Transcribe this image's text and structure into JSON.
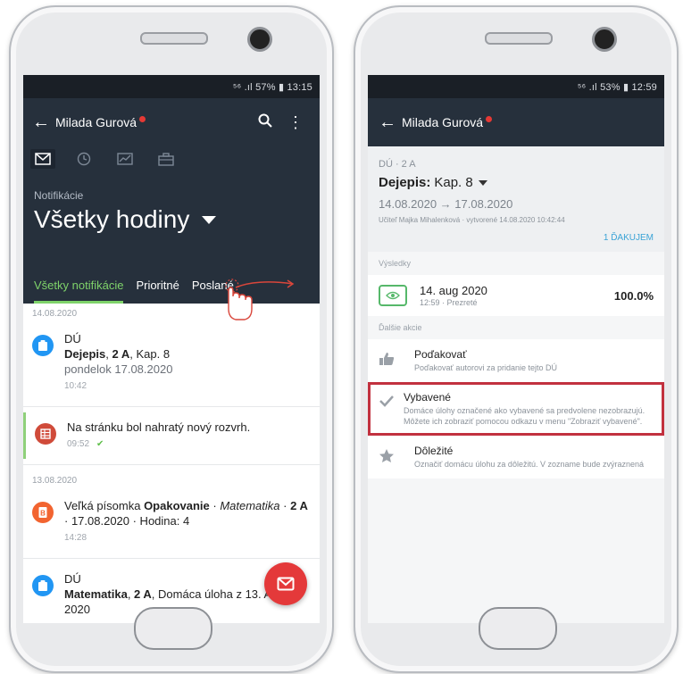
{
  "left_screen": {
    "statusbar": {
      "text": "⁵⁶ .ıl 57% ▮ 13:15"
    },
    "appbar": {
      "user_name": "Milada Gurová"
    },
    "hero": {
      "label": "Notifikácie",
      "title": "Všetky hodiny"
    },
    "tabs": [
      {
        "label": "Všetky notifikácie",
        "active": true
      },
      {
        "label": "Prioritné",
        "active": false
      },
      {
        "label": "Poslané",
        "active": false
      }
    ],
    "groups": [
      {
        "date": "14.08.2020",
        "items": [
          {
            "title": "DÚ",
            "line_bold": "Dejepis",
            "line_bold2": "2 A",
            "line_rest": ", Kap. 8",
            "line2": "pondelok 17.08.2020",
            "time": "10:42",
            "avatar_color": "#2196f3"
          },
          {
            "text": "Na stránku bol nahratý nový rozvrh.",
            "time": "09:52",
            "avatar_color": "#d04b3a"
          }
        ]
      },
      {
        "date": "13.08.2020",
        "items": [
          {
            "text_pre": "Veľká písomka ",
            "text_bold": "Opakovanie",
            "text_after": " · ",
            "text_italic": "Matematika",
            "text_mid": " · ",
            "text_bold2": "2 A",
            "text_end": " · 17.08.2020 · Hodina: 4",
            "time": "14:28",
            "avatar_color": "#f26430"
          },
          {
            "title": "DÚ",
            "line_bold": "Matematika",
            "line_bold2": "2 A",
            "line_rest": ", Domáca úloha z 13. Aug 2020",
            "avatar_color": "#2196f3"
          }
        ]
      }
    ]
  },
  "right_screen": {
    "statusbar": {
      "text": "⁵⁶ .ıl 53% ▮ 12:59"
    },
    "appbar": {
      "user_name": "Milada Gurová"
    },
    "header": {
      "kicker": "DÚ · 2 A",
      "subject_bold": "Dejepis:",
      "subject_rest": "Kap. 8",
      "dates": "14.08.2020 → 17.08.2020",
      "teacher": "Učiteľ Majka Mihalenková · vytvorené 14.08.2020 10:42:44",
      "thanks": "1 ĎAKUJEM"
    },
    "results_label": "Výsledky",
    "result": {
      "date": "14. aug 2020",
      "sub": "12:59 · Prezreté",
      "value": "100.0%"
    },
    "actions_label": "Ďalšie akcie",
    "actions": [
      {
        "title": "Poďakovať",
        "desc": "Poďakovať autorovi za pridanie tejto DÚ",
        "icon": "thumbs-up-icon"
      },
      {
        "title": "Vybavené",
        "desc": "Domáce úlohy označené ako vybavené sa predvolene nezobrazujú. Môžete ich zobraziť pomocou odkazu v menu \"Zobraziť vybavené\".",
        "icon": "check-icon"
      },
      {
        "title": "Dôležité",
        "desc": "Označiť domácu úlohu za dôležitú. V zozname bude zvýraznená",
        "icon": "star-icon"
      }
    ]
  },
  "colors": {
    "appbar": "#26303c",
    "accent_green": "#7fd36a",
    "fab_red": "#e4393a",
    "highlight_box": "#c2313f"
  }
}
